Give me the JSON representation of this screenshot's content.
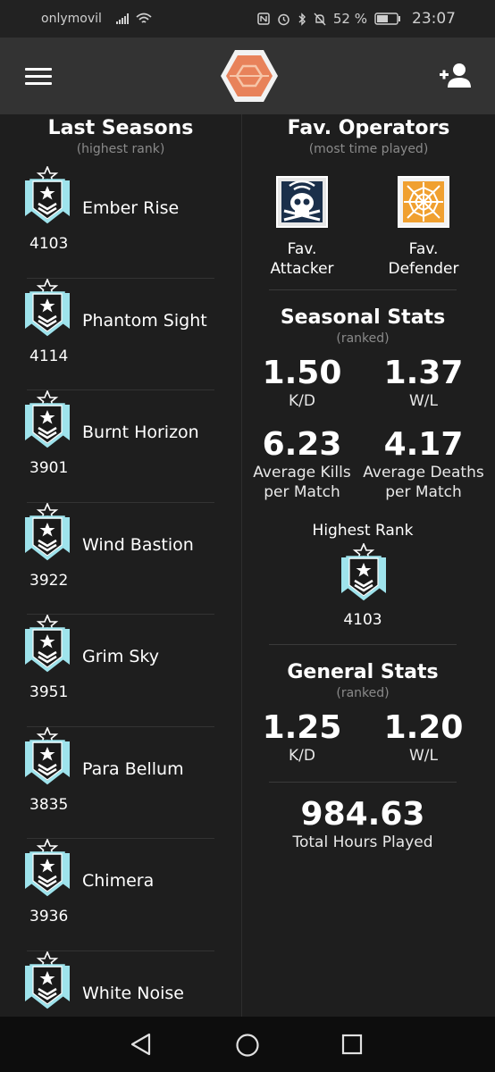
{
  "status_bar": {
    "carrier": "onlymovil",
    "battery": "52 %",
    "time": "23:07"
  },
  "app_bar": {
    "menu_icon": "hamburger-icon",
    "logo_icon": "hexagon-logo-icon",
    "add_user_icon": "person-add-icon"
  },
  "last_seasons": {
    "title": "Last Seasons",
    "subtitle": "(highest rank)",
    "items": [
      {
        "name": "Ember Rise",
        "mmr": "4103",
        "rank": "platinum"
      },
      {
        "name": "Phantom Sight",
        "mmr": "4114",
        "rank": "platinum"
      },
      {
        "name": "Burnt Horizon",
        "mmr": "3901",
        "rank": "platinum"
      },
      {
        "name": "Wind Bastion",
        "mmr": "3922",
        "rank": "platinum"
      },
      {
        "name": "Grim Sky",
        "mmr": "3951",
        "rank": "platinum"
      },
      {
        "name": "Para Bellum",
        "mmr": "3835",
        "rank": "platinum"
      },
      {
        "name": "Chimera",
        "mmr": "3936",
        "rank": "platinum"
      },
      {
        "name": "White Noise",
        "mmr": "",
        "rank": "platinum"
      }
    ]
  },
  "fav_operators": {
    "title": "Fav. Operators",
    "subtitle": "(most time played)",
    "attacker": {
      "label_line1": "Fav.",
      "label_line2": "Attacker",
      "icon": "skull-operator-icon"
    },
    "defender": {
      "label_line1": "Fav.",
      "label_line2": "Defender",
      "icon": "web-operator-icon"
    }
  },
  "seasonal_stats": {
    "title": "Seasonal Stats",
    "subtitle": "(ranked)",
    "kd": {
      "value": "1.50",
      "label": "K/D"
    },
    "wl": {
      "value": "1.37",
      "label": "W/L"
    },
    "avg_kills": {
      "value": "6.23",
      "label_line1": "Average Kills",
      "label_line2": "per Match"
    },
    "avg_deaths": {
      "value": "4.17",
      "label_line1": "Average Deaths",
      "label_line2": "per Match"
    },
    "highest_rank": {
      "label": "Highest Rank",
      "mmr": "4103"
    }
  },
  "general_stats": {
    "title": "General Stats",
    "subtitle": "(ranked)",
    "kd": {
      "value": "1.25",
      "label": "K/D"
    },
    "wl": {
      "value": "1.20",
      "label": "W/L"
    },
    "hours": {
      "value": "984.63",
      "label": "Total Hours Played"
    }
  },
  "colors": {
    "accent": "#e8825a",
    "rank_badge": "#9ee3ec",
    "background": "#1e1e1e",
    "app_bar": "#333333"
  }
}
